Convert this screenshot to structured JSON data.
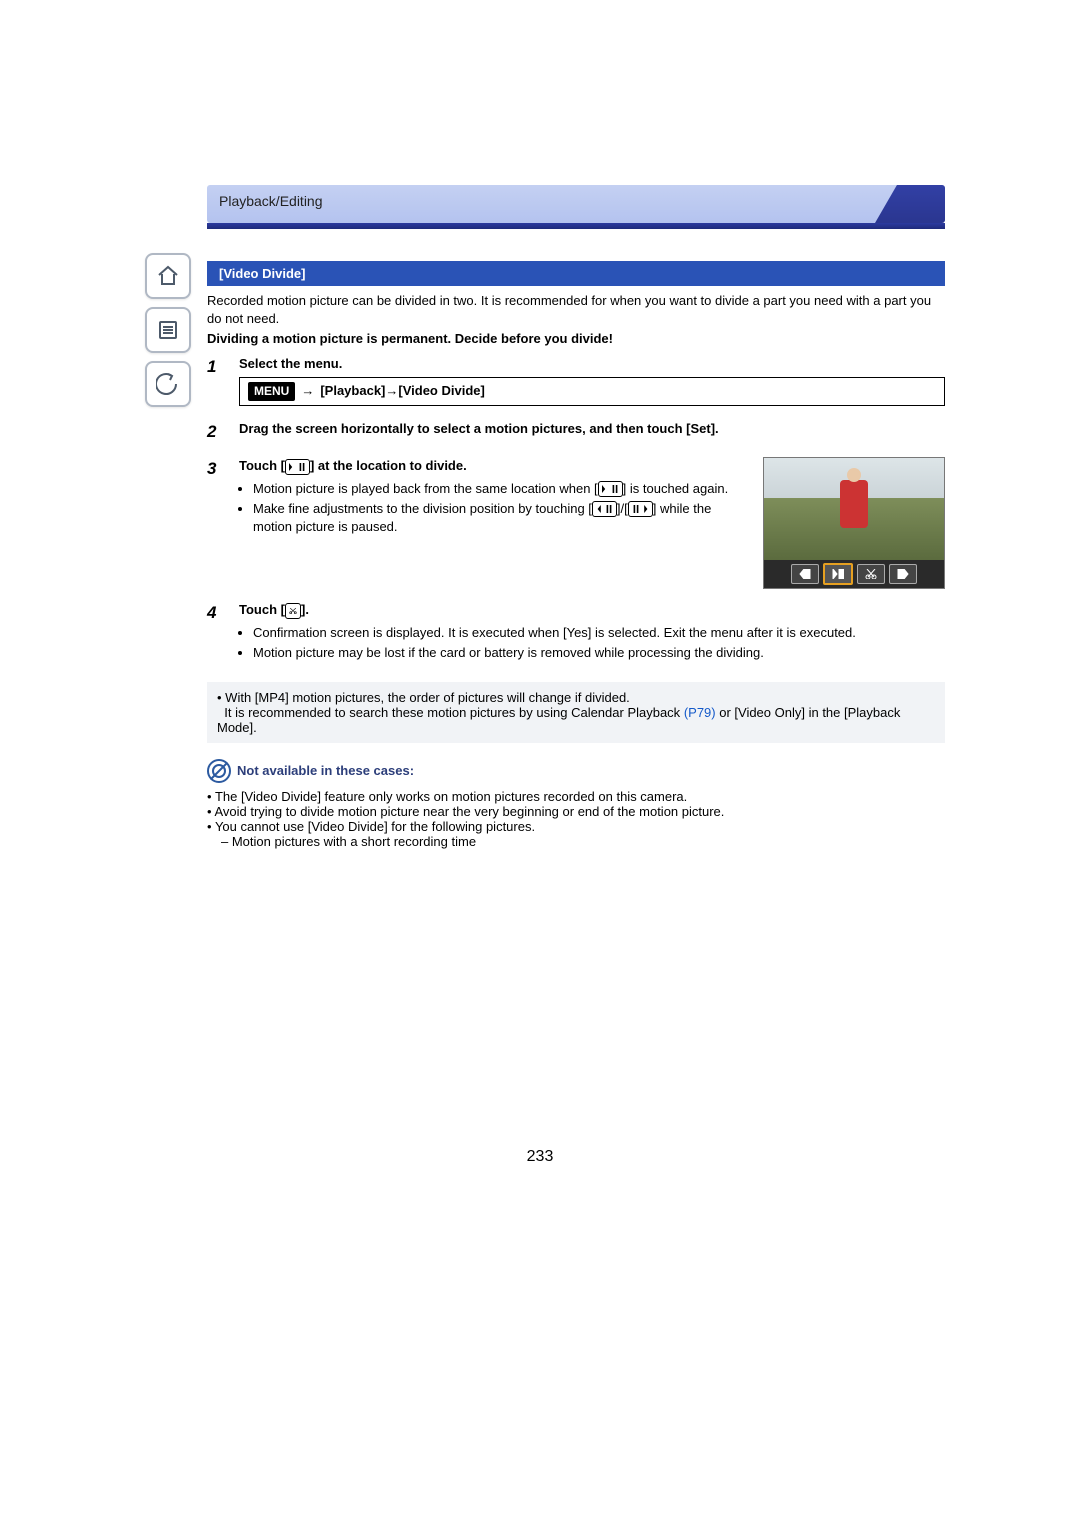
{
  "header": {
    "breadcrumb": "Playback/Editing"
  },
  "section": {
    "title": "[Video Divide]"
  },
  "intro": {
    "p1": "Recorded motion picture can be divided in two. It is recommended for when you want to divide a part you need with a part you do not need.",
    "warn": "Dividing a motion picture is permanent. Decide before you divide!"
  },
  "steps": {
    "s1": {
      "num": "1",
      "title": "Select the menu.",
      "menu_label": "MENU",
      "menu_arrow": "→",
      "menu_path": "[Playback]→[Video Divide]"
    },
    "s2": {
      "num": "2",
      "title": "Drag the screen horizontally to select a motion pictures, and then touch [Set]."
    },
    "s3": {
      "num": "3",
      "title_a": "Touch [",
      "title_b": "] at the location to divide.",
      "b1a": "Motion picture is played back from the same location when [",
      "b1b": "] is touched again.",
      "b2a": "Make fine adjustments to the division position by touching [",
      "b2b": "]/[",
      "b2c": "] while the motion picture is paused."
    },
    "s4": {
      "num": "4",
      "title_a": "Touch [",
      "title_b": "].",
      "b1": "Confirmation screen is displayed. It is executed when [Yes] is selected. Exit the menu after it is executed.",
      "b2": "Motion picture may be lost if the card or battery is removed while processing the dividing."
    }
  },
  "note": {
    "l1": "With [MP4] motion pictures, the order of pictures will change if divided.",
    "l2a": "It is recommended to search these motion pictures by using Calendar Playback ",
    "l2link": "(P79)",
    "l2b": " or [Video Only] in the [Playback Mode]."
  },
  "not_available": {
    "title": "Not available in these cases:",
    "i1": "The [Video Divide] feature only works on motion pictures recorded on this camera.",
    "i2": "Avoid trying to divide motion picture near the very beginning or end of the motion picture.",
    "i3": "You cannot use [Video Divide] for the following pictures.",
    "i3a": "Motion pictures with a short recording time"
  },
  "page_number": "233",
  "nav": {
    "home": "home",
    "toc": "contents",
    "back": "back"
  }
}
